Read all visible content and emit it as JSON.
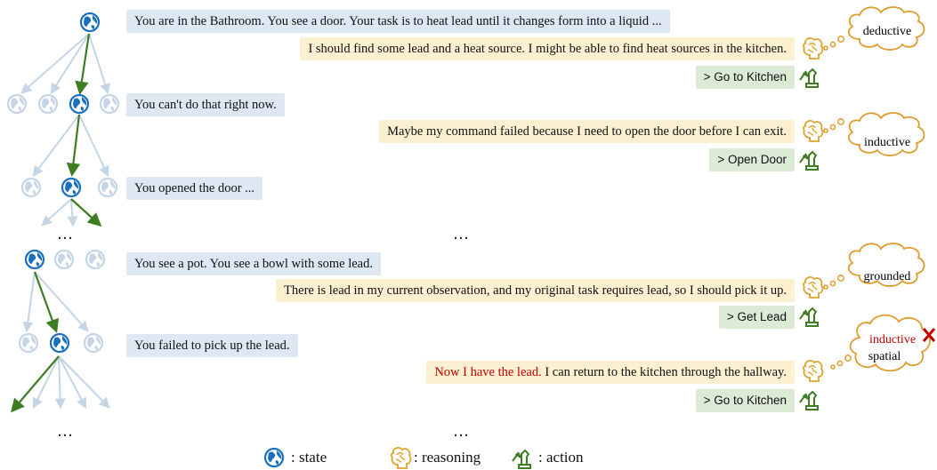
{
  "rows": [
    {
      "observation": "You are in the Bathroom. You see a door. Your task is to heat lead until it changes form into a liquid ...",
      "reasoning": "I should find some lead and a heat source. I might be able to find heat sources in the kitchen.",
      "action": "> Go to Kitchen",
      "reasoning_type": "deductive"
    },
    {
      "observation": "You can't do that right now.",
      "reasoning": "Maybe my command failed because I need to open the door before I can exit.",
      "action": "> Open Door",
      "reasoning_type": "inductive"
    },
    {
      "observation": "You opened the door ..."
    },
    {
      "observation": "You see a pot. You see a bowl with some lead.",
      "reasoning": "There is lead in my current observation, and my original task requires lead, so I should pick it up.",
      "action": "> Get Lead",
      "reasoning_type": "grounded"
    },
    {
      "observation": "You failed to pick up the lead.",
      "reasoning_wrong": "Now I have the lead.",
      "reasoning_rest": " I can return to the kitchen through the hallway.",
      "action": "> Go to Kitchen",
      "reasoning_type_wrong": "inductive",
      "reasoning_type": "spatial"
    }
  ],
  "ellipsis": "…",
  "legend": {
    "state": ": state",
    "reasoning": ": reasoning",
    "action": ": action"
  },
  "colors": {
    "state_blue": "#1a6fbf",
    "tree_arrow": "#3e7d22",
    "faded": "#c4d5e6",
    "obs_bg": "#dde8f3",
    "rsn_bg": "#fbf0cf",
    "act_bg": "#dcebd6",
    "cloud_stroke": "#e09b2d",
    "error_red": "#c00000"
  }
}
